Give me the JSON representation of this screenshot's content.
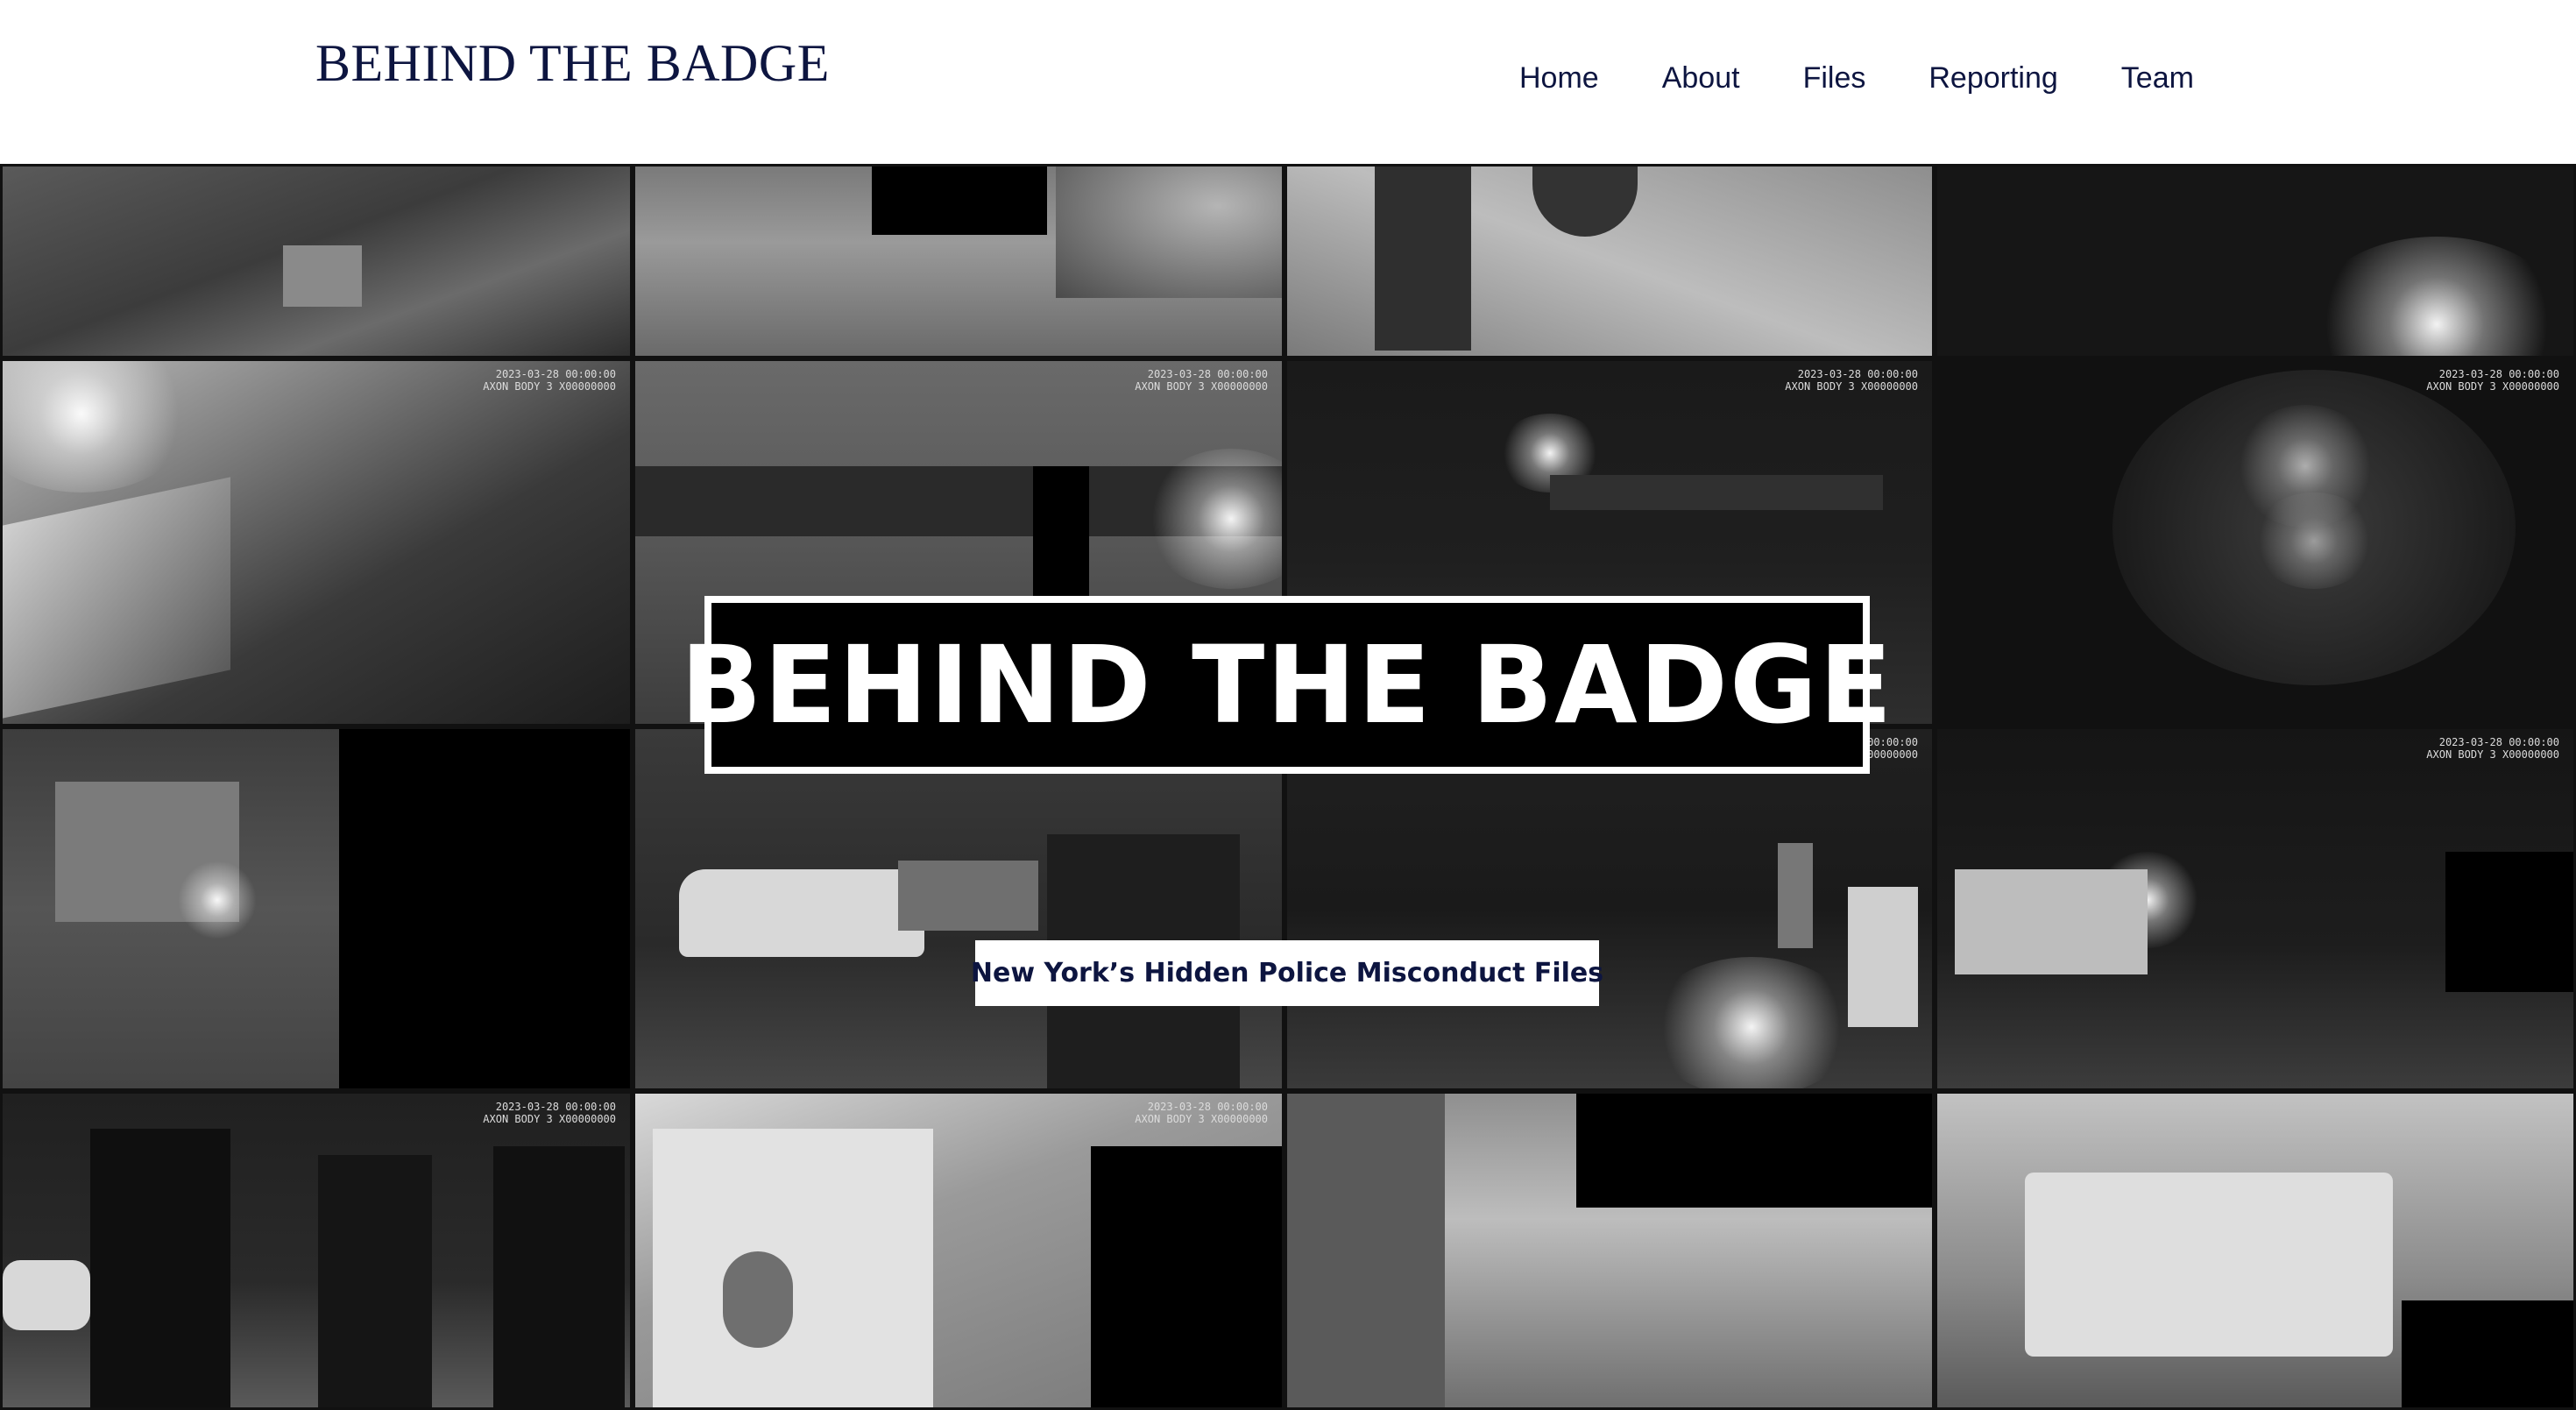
{
  "site": {
    "logo_text": "BEHIND THE BADGE"
  },
  "nav": {
    "items": [
      {
        "label": "Home"
      },
      {
        "label": "About"
      },
      {
        "label": "Files"
      },
      {
        "label": "Reporting"
      },
      {
        "label": "Team"
      }
    ]
  },
  "hero": {
    "title": "BEHIND THE BADGE",
    "subtitle": "New York’s Hidden Police Misconduct Files",
    "background": "bodycam-footage-collage"
  },
  "colors": {
    "brand_navy": "#0d1540",
    "header_bg": "#ffffff",
    "hero_bg": "#0b0b0b",
    "title_box_bg": "#000000",
    "title_box_border": "#ffffff"
  }
}
